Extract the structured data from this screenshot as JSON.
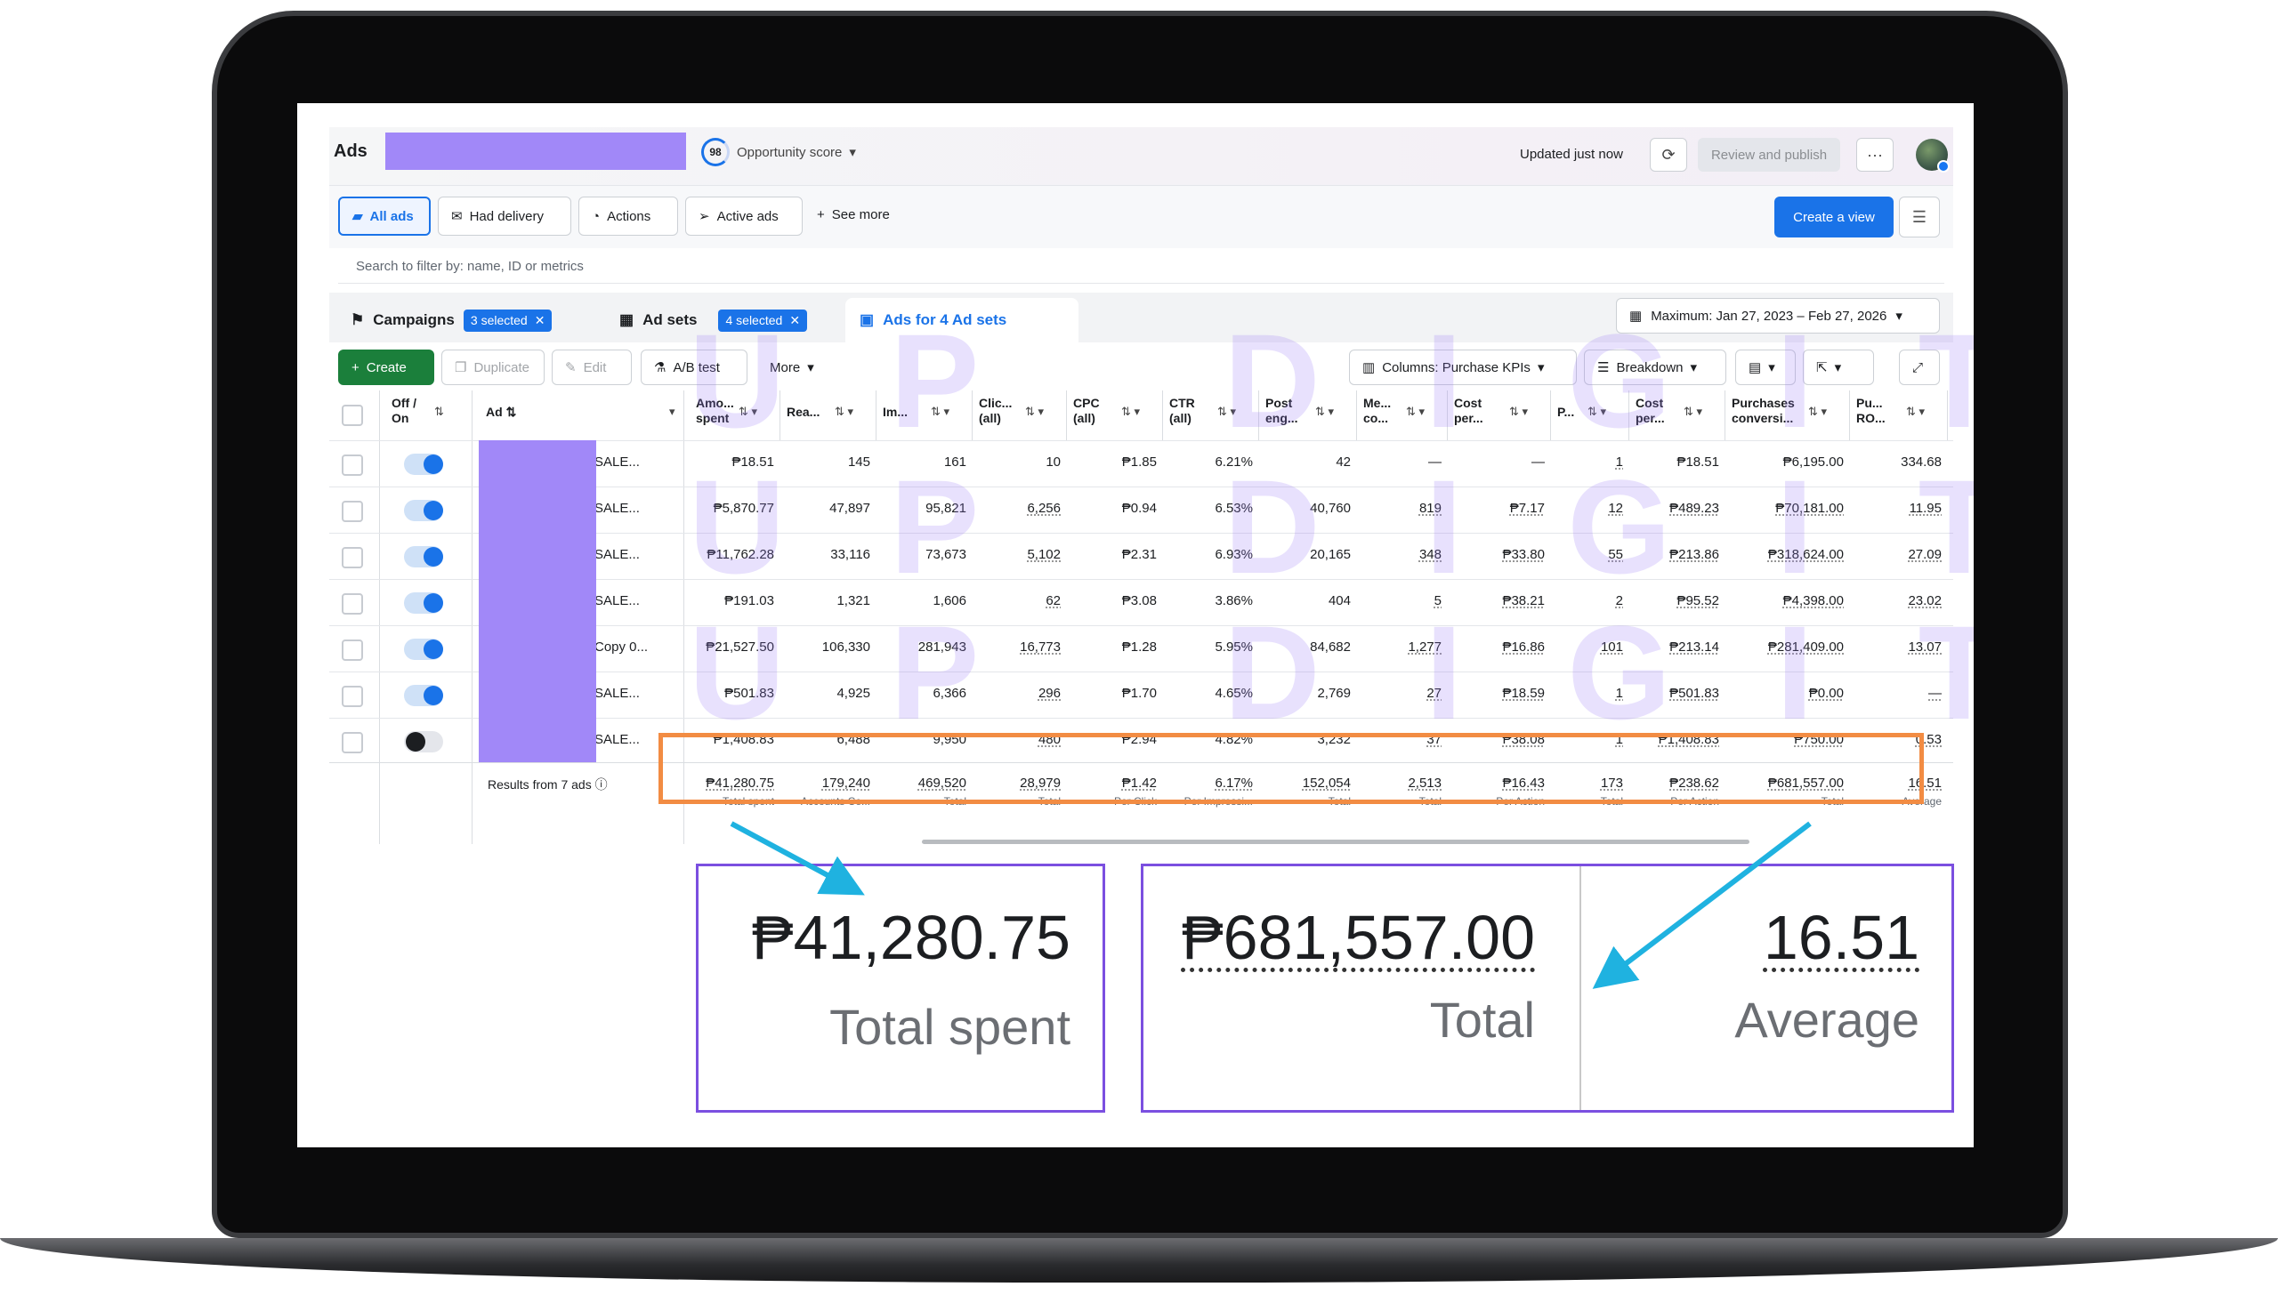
{
  "header": {
    "title": "Ads",
    "opportunity_score": "98",
    "opportunity_label": "Opportunity score",
    "updated": "Updated just now",
    "review_publish": "Review and publish",
    "more_dots": "···"
  },
  "filters": {
    "all_ads": "All ads",
    "had_delivery": "Had delivery",
    "actions": "Actions",
    "active_ads": "Active ads",
    "see_more": "See more",
    "create_view": "Create a view"
  },
  "search": {
    "placeholder": "Search to filter by: name, ID or metrics"
  },
  "levels": {
    "campaigns": "Campaigns",
    "campaigns_selected": "3 selected",
    "ad_sets": "Ad sets",
    "ad_sets_selected": "4 selected",
    "ads_for": "Ads for 4 Ad sets",
    "date_range": "Maximum: Jan 27, 2023 – Feb 27, 2026"
  },
  "toolbar": {
    "create": "Create",
    "duplicate": "Duplicate",
    "edit": "Edit",
    "ab_test": "A/B test",
    "more": "More",
    "columns": "Columns: Purchase KPIs",
    "breakdown": "Breakdown"
  },
  "columns": {
    "off_on": [
      "Off /",
      "On"
    ],
    "ad": "Ad",
    "amount": [
      "Amo...",
      "spent"
    ],
    "reach": "Rea...",
    "impressions": "Im...",
    "clicks": [
      "Clic...",
      "(all)"
    ],
    "cpc": [
      "CPC",
      "(all)"
    ],
    "ctr": [
      "CTR",
      "(all)"
    ],
    "post_eng": [
      "Post",
      "eng..."
    ],
    "messaging": [
      "Me...",
      "co..."
    ],
    "cost_per_1": [
      "Cost",
      "per..."
    ],
    "purchases": "P...",
    "cost_per_2": [
      "Cost",
      "per..."
    ],
    "purchases_conv": [
      "Purchases",
      "conversi..."
    ],
    "roas": [
      "Pu...",
      "RO..."
    ]
  },
  "rows": [
    {
      "on": true,
      "name": "SALE...",
      "amount": "₱18.51",
      "reach": "145",
      "imp": "161",
      "clicks": "10",
      "cpc": "₱1.85",
      "ctr": "6.21%",
      "eng": "42",
      "msg": "—",
      "cpr1": "—",
      "pur": "1",
      "cpr2": "₱18.51",
      "conv": "₱6,195.00",
      "roas": "334.68"
    },
    {
      "on": true,
      "name": "SALE...",
      "amount": "₱5,870.77",
      "reach": "47,897",
      "imp": "95,821",
      "clicks": "6,256",
      "cpc": "₱0.94",
      "ctr": "6.53%",
      "eng": "40,760",
      "msg": "819",
      "cpr1": "₱7.17",
      "pur": "12",
      "cpr2": "₱489.23",
      "conv": "₱70,181.00",
      "roas": "11.95"
    },
    {
      "on": true,
      "name": "SALE...",
      "amount": "₱11,762.28",
      "reach": "33,116",
      "imp": "73,673",
      "clicks": "5,102",
      "cpc": "₱2.31",
      "ctr": "6.93%",
      "eng": "20,165",
      "msg": "348",
      "cpr1": "₱33.80",
      "pur": "55",
      "cpr2": "₱213.86",
      "conv": "₱318,624.00",
      "roas": "27.09"
    },
    {
      "on": true,
      "name": "SALE...",
      "amount": "₱191.03",
      "reach": "1,321",
      "imp": "1,606",
      "clicks": "62",
      "cpc": "₱3.08",
      "ctr": "3.86%",
      "eng": "404",
      "msg": "5",
      "cpr1": "₱38.21",
      "pur": "2",
      "cpr2": "₱95.52",
      "conv": "₱4,398.00",
      "roas": "23.02"
    },
    {
      "on": true,
      "name": "Copy 0...",
      "amount": "₱21,527.50",
      "reach": "106,330",
      "imp": "281,943",
      "clicks": "16,773",
      "cpc": "₱1.28",
      "ctr": "5.95%",
      "eng": "84,682",
      "msg": "1,277",
      "cpr1": "₱16.86",
      "pur": "101",
      "cpr2": "₱213.14",
      "conv": "₱281,409.00",
      "roas": "13.07"
    },
    {
      "on": true,
      "name": "SALE...",
      "amount": "₱501.83",
      "reach": "4,925",
      "imp": "6,366",
      "clicks": "296",
      "cpc": "₱1.70",
      "ctr": "4.65%",
      "eng": "2,769",
      "msg": "27",
      "cpr1": "₱18.59",
      "pur": "1",
      "cpr2": "₱501.83",
      "conv": "₱0.00",
      "roas": "—"
    },
    {
      "on": false,
      "name": "SALE...",
      "amount": "₱1,408.83",
      "reach": "6,488",
      "imp": "9,950",
      "clicks": "480",
      "cpc": "₱2.94",
      "ctr": "4.82%",
      "eng": "3,232",
      "msg": "37",
      "cpr1": "₱38.08",
      "pur": "1",
      "cpr2": "₱1,408.83",
      "conv": "₱750.00",
      "roas": "0.53"
    }
  ],
  "totals": {
    "label": "Results from 7 ads",
    "amount": "₱41,280.75",
    "amount_sub": "Total spent",
    "reach": "179,240",
    "reach_sub": "Accounts Ce...",
    "imp": "469,520",
    "imp_sub": "Total",
    "clicks": "28,979",
    "clicks_sub": "Total",
    "cpc": "₱1.42",
    "cpc_sub": "Per Click",
    "ctr": "6.17%",
    "ctr_sub": "Per Impressi...",
    "eng": "152,054",
    "eng_sub": "Total",
    "msg": "2,513",
    "msg_sub": "Total",
    "cpr1": "₱16.43",
    "cpr1_sub": "Per Action",
    "pur": "173",
    "pur_sub": "Total",
    "cpr2": "₱238.62",
    "cpr2_sub": "Per Action",
    "conv": "₱681,557.00",
    "conv_sub": "Total",
    "roas": "16.51",
    "roas_sub": "Average"
  },
  "zoom": {
    "spent_value": "₱41,280.75",
    "spent_label": "Total spent",
    "conv_value": "₱681,557.00",
    "conv_label": "Total",
    "roas_value": "16.51",
    "roas_label": "Average"
  },
  "watermark": "UP DIGITAL",
  "colors": {
    "accent": "#1a73e8",
    "highlight": "#f28c43",
    "zoom_border": "#7b4fe0",
    "arrow": "#1fb2e0",
    "redaction": "#a188f8"
  }
}
